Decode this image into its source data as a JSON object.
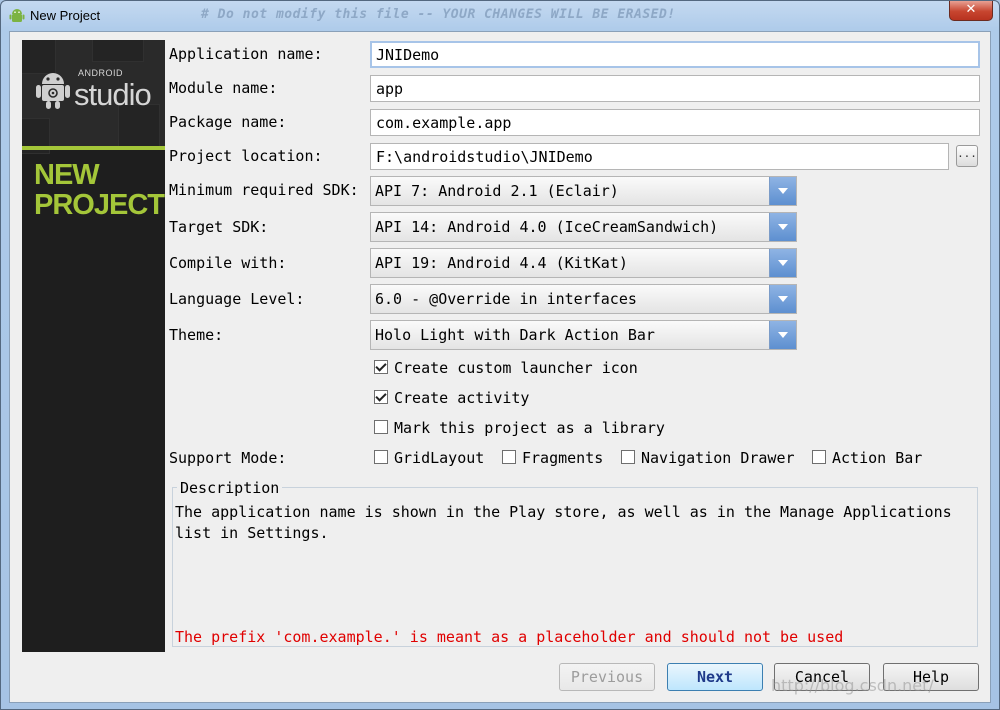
{
  "window": {
    "title": "New Project",
    "close_glyph": "✕",
    "watermark_top": "# Do not modify this file -- YOUR CHANGES WILL BE ERASED!"
  },
  "banner": {
    "android_label": "ANDROID",
    "studio_label": "studio",
    "heading_line1": "NEW",
    "heading_line2": "PROJECT"
  },
  "form": {
    "app_name_label": "Application name:",
    "app_name_value": "JNIDemo",
    "module_name_label": "Module name:",
    "module_name_value": "app",
    "package_name_label": "Package name:",
    "package_name_value": "com.example.app",
    "project_location_label": "Project location:",
    "project_location_value": "F:\\androidstudio\\JNIDemo",
    "browse_label": "...",
    "min_sdk_label": "Minimum required SDK:",
    "min_sdk_value": "API 7: Android 2.1 (Eclair)",
    "target_sdk_label": "Target SDK:",
    "target_sdk_value": "API 14: Android 4.0 (IceCreamSandwich)",
    "compile_with_label": "Compile with:",
    "compile_with_value": "API 19: Android 4.4 (KitKat)",
    "language_level_label": "Language Level:",
    "language_level_value": "6.0 - @Override in interfaces",
    "theme_label": "Theme:",
    "theme_value": "Holo Light with Dark Action Bar"
  },
  "options": {
    "launcher_icon": {
      "label": "Create custom launcher icon",
      "checked": true
    },
    "create_activity": {
      "label": "Create activity",
      "checked": true
    },
    "library": {
      "label": "Mark this project as a library",
      "checked": false
    }
  },
  "support_mode": {
    "label": "Support Mode:",
    "grid_layout": "GridLayout",
    "fragments": "Fragments",
    "navigation_drawer": "Navigation Drawer",
    "action_bar": "Action Bar"
  },
  "description": {
    "legend": "Description",
    "text": "The application name is shown in the Play store, as well as in the Manage Applications list in Settings.",
    "warning": "The prefix 'com.example.' is meant as a placeholder and should not be used"
  },
  "buttons": {
    "previous": "Previous",
    "next": "Next",
    "cancel": "Cancel",
    "help": "Help"
  },
  "watermark_bottom": "http://blog.csdn.net/",
  "colors": {
    "android_green": "#a4c639",
    "warning_red": "#e00000",
    "combo_arrow_blue": "#5d8fd0"
  }
}
